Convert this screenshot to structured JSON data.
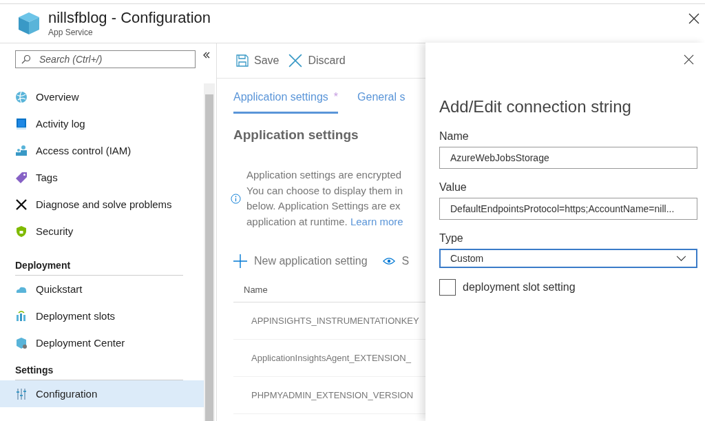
{
  "header": {
    "title": "nillsfblog - Configuration",
    "subtitle": "App Service"
  },
  "sidebar": {
    "search": {
      "placeholder": "Search (Ctrl+/)"
    },
    "groups": [
      {
        "items": [
          {
            "label": "Overview",
            "kind": "globe",
            "selected": false
          },
          {
            "label": "Activity log",
            "kind": "book",
            "selected": false
          },
          {
            "label": "Access control (IAM)",
            "kind": "people",
            "selected": false
          },
          {
            "label": "Tags",
            "kind": "tag",
            "selected": false
          },
          {
            "label": "Diagnose and solve problems",
            "kind": "tools",
            "selected": false
          },
          {
            "label": "Security",
            "kind": "shield",
            "selected": false
          }
        ]
      },
      {
        "heading": "Deployment",
        "items": [
          {
            "label": "Quickstart",
            "kind": "cloud",
            "selected": false
          },
          {
            "label": "Deployment slots",
            "kind": "slots",
            "selected": false
          },
          {
            "label": "Deployment Center",
            "kind": "cube",
            "selected": false
          }
        ]
      },
      {
        "heading": "Settings",
        "items": [
          {
            "label": "Configuration",
            "kind": "sliders",
            "selected": true
          }
        ]
      }
    ]
  },
  "toolbar": [
    {
      "label": "Save",
      "kind": "save"
    },
    {
      "label": "Discard",
      "kind": "discard"
    }
  ],
  "tabs": [
    {
      "label": "Application settings",
      "badge": "*",
      "selected": true
    },
    {
      "label": "General s",
      "selected": false
    }
  ],
  "section_title": "Application settings",
  "info": {
    "lines": [
      "Application settings are encrypted",
      "You can choose to display them in",
      "below. Application Settings are ex",
      "application at runtime."
    ],
    "link": "Learn more"
  },
  "actions": [
    {
      "label": "New application setting",
      "kind": "add"
    },
    {
      "label": "S",
      "kind": "show"
    }
  ],
  "table": {
    "columns": [
      "Name"
    ],
    "rows": [
      [
        "APPINSIGHTS_INSTRUMENTATIONKEY"
      ],
      [
        "ApplicationInsightsAgent_EXTENSION_"
      ],
      [
        "PHPMYADMIN_EXTENSION_VERSION"
      ]
    ]
  },
  "panel": {
    "title": "Add/Edit connection string",
    "fields": [
      {
        "label": "Name",
        "value": "AzureWebJobsStorage",
        "kind": "text"
      },
      {
        "label": "Value",
        "value": "DefaultEndpointsProtocol=https;AccountName=nill...",
        "kind": "text"
      },
      {
        "label": "Type",
        "value": "Custom",
        "kind": "select"
      }
    ],
    "checkbox": {
      "label": "deployment slot setting",
      "checked": false
    }
  }
}
